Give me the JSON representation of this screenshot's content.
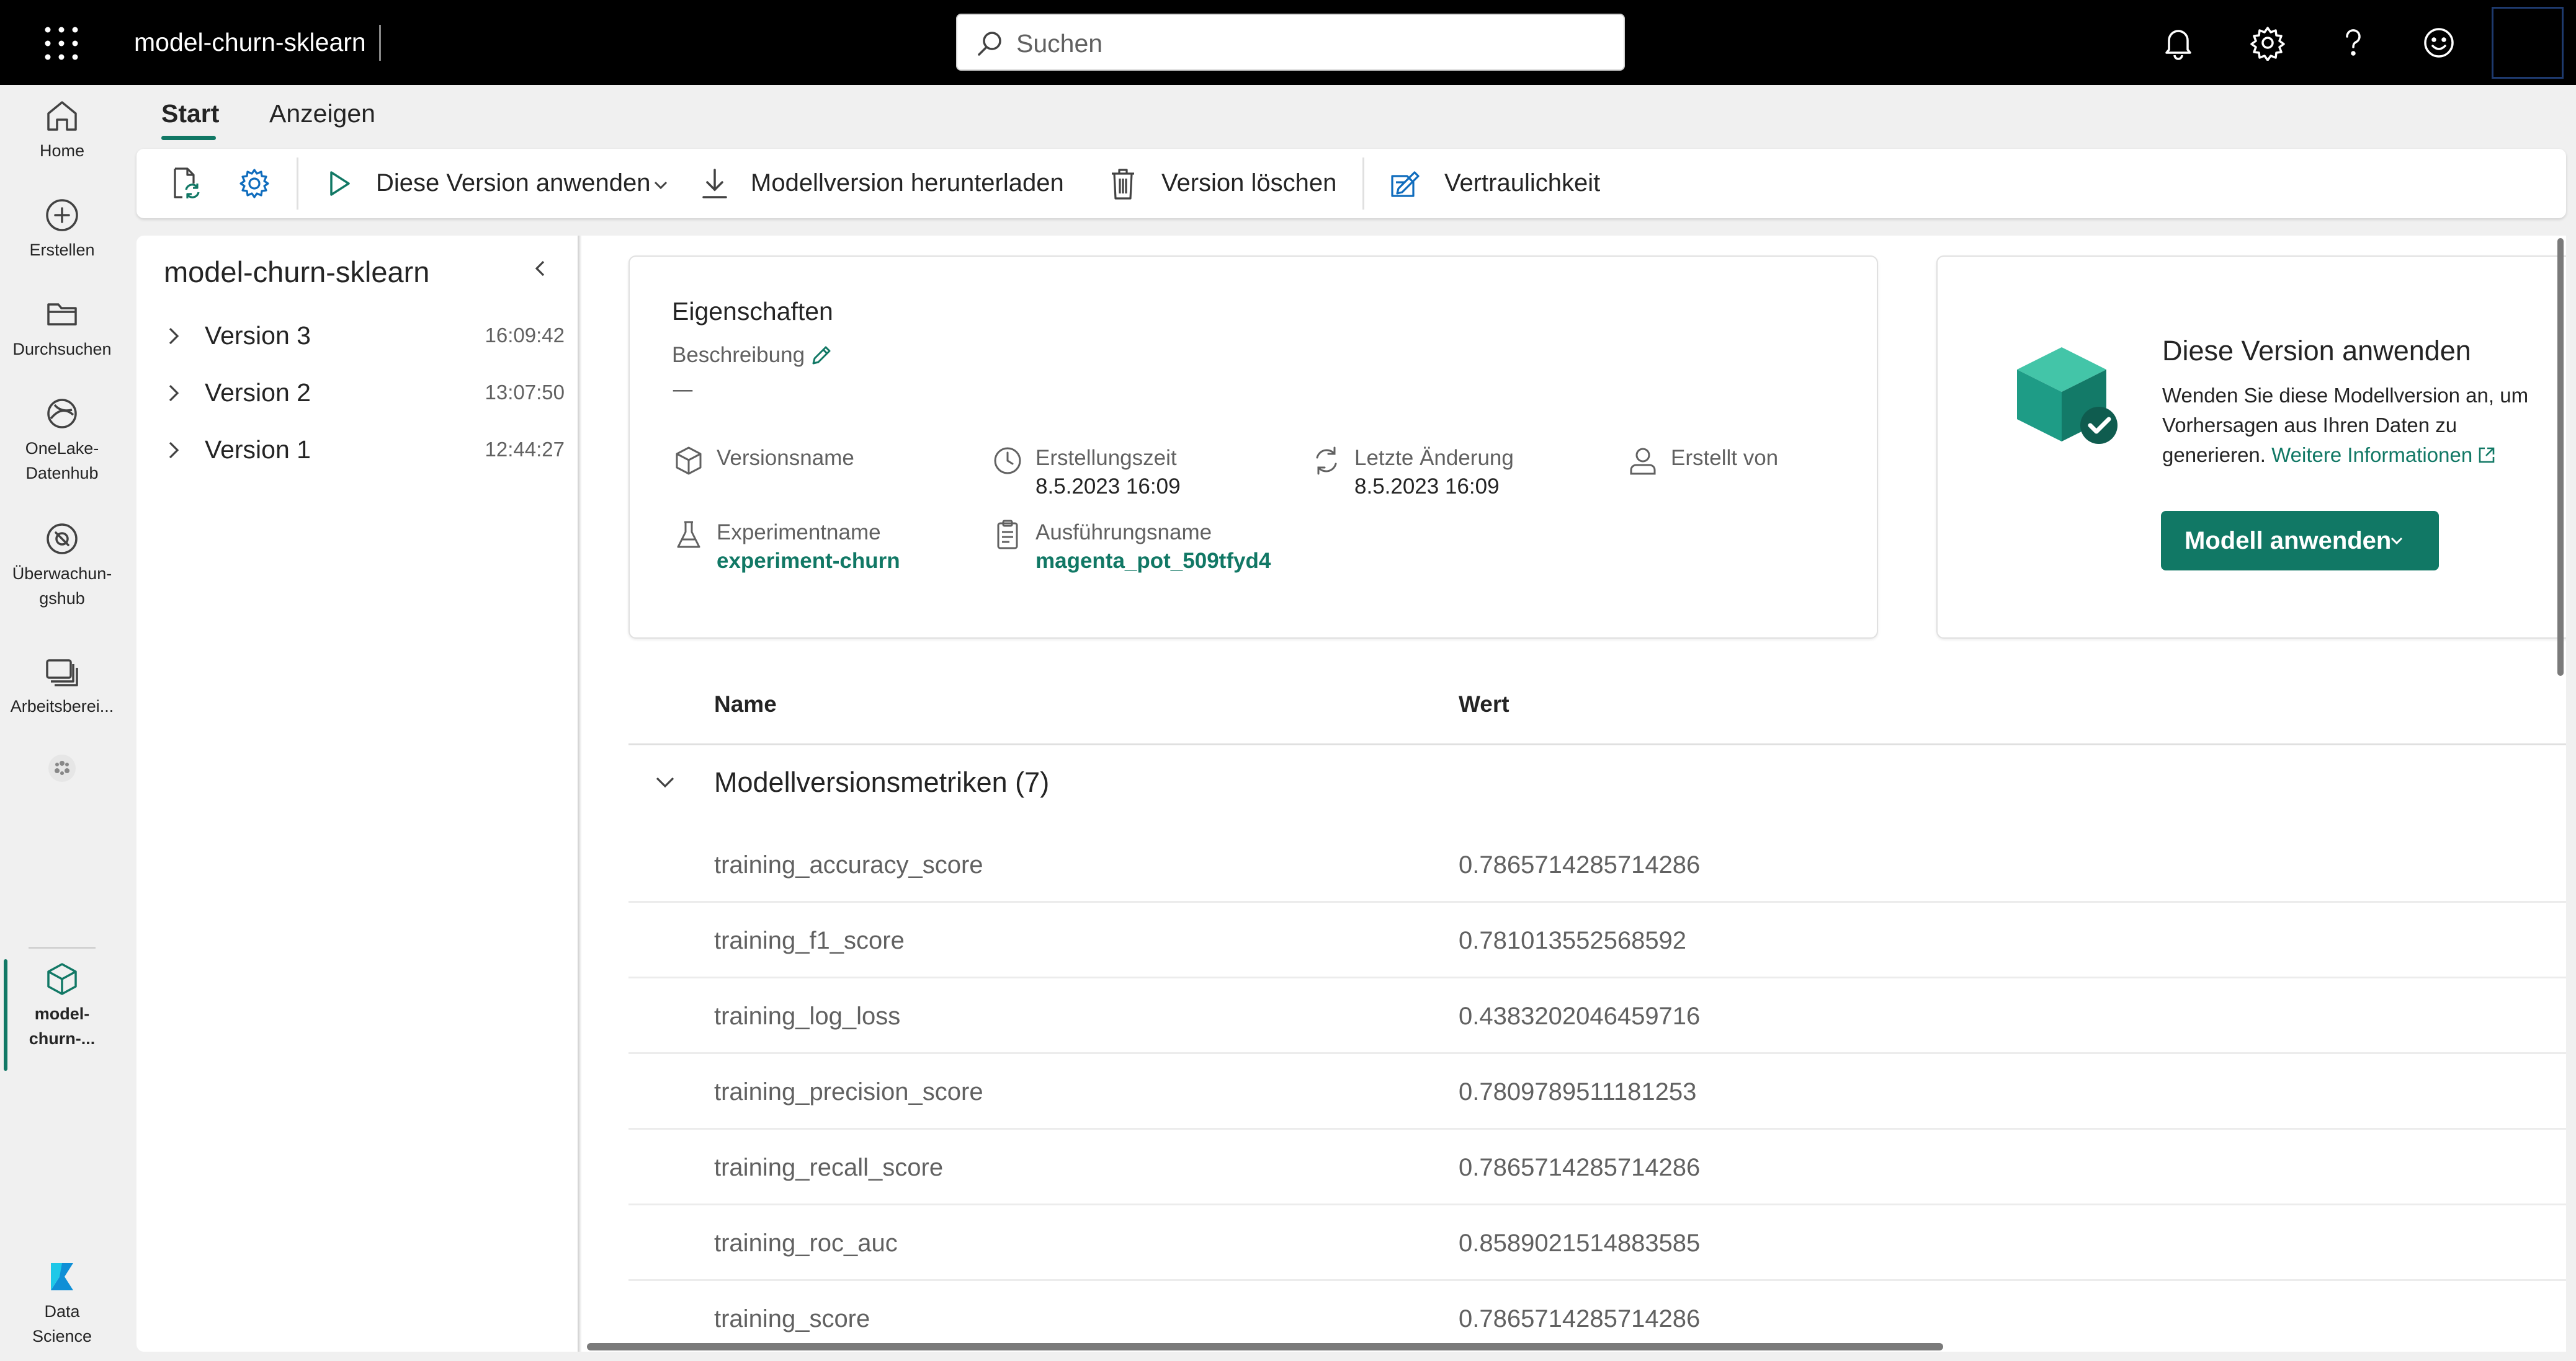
{
  "colors": {
    "accent": "#117865",
    "topbar": "#000000",
    "icon_gray": "#616161"
  },
  "header": {
    "app_title": "model-churn-sklearn",
    "search_placeholder": "Suchen"
  },
  "rail": {
    "items": [
      {
        "label": "Home",
        "icon": "home-icon"
      },
      {
        "label": "Erstellen",
        "icon": "plus-circle-icon"
      },
      {
        "label": "Durchsuchen",
        "icon": "folder-icon"
      },
      {
        "label": "OneLake-Datenhub",
        "icon": "onelake-icon"
      },
      {
        "label": "Überwachun-gshub",
        "icon": "monitor-icon"
      },
      {
        "label": "Arbeitsberei...",
        "icon": "workspaces-icon"
      },
      {
        "label": "",
        "icon": "workspace-avatar-icon"
      },
      {
        "label": "model-churn-...",
        "icon": "model-cube-icon"
      },
      {
        "label": "Data Science",
        "icon": "data-science-icon"
      }
    ]
  },
  "tabs": [
    {
      "label": "Start"
    },
    {
      "label": "Anzeigen"
    }
  ],
  "ribbon": {
    "apply_version": "Diese Version anwenden",
    "download": "Modellversion herunterladen",
    "delete": "Version löschen",
    "sensitivity": "Vertraulichkeit"
  },
  "versions_panel": {
    "title": "model-churn-sklearn",
    "items": [
      {
        "name": "Version 3",
        "time": "16:09:42"
      },
      {
        "name": "Version 2",
        "time": "13:07:50"
      },
      {
        "name": "Version 1",
        "time": "12:44:27"
      }
    ]
  },
  "properties": {
    "title": "Eigenschaften",
    "description_label": "Beschreibung",
    "description_value": "—",
    "version_name_label": "Versionsname",
    "version_name_value": "",
    "created_label": "Erstellungszeit",
    "created_value": "8.5.2023 16:09",
    "modified_label": "Letzte Änderung",
    "modified_value": "8.5.2023 16:09",
    "created_by_label": "Erstellt von",
    "created_by_value": "",
    "experiment_label": "Experimentname",
    "experiment_value": "experiment-churn",
    "run_label": "Ausführungsname",
    "run_value": "magenta_pot_509tfyd4"
  },
  "apply_card": {
    "title": "Diese Version anwenden",
    "description": "Wenden Sie diese Modellversion an, um Vorhersagen aus Ihren Daten zu generieren.",
    "link": "Weitere Informationen",
    "button": "Modell anwenden"
  },
  "metrics_table": {
    "col_name": "Name",
    "col_value": "Wert",
    "group_title": "Modellversionsmetriken (7)",
    "rows": [
      {
        "name": "training_accuracy_score",
        "value": "0.7865714285714286"
      },
      {
        "name": "training_f1_score",
        "value": "0.781013552568592"
      },
      {
        "name": "training_log_loss",
        "value": "0.4383202046459716"
      },
      {
        "name": "training_precision_score",
        "value": "0.7809789511181253"
      },
      {
        "name": "training_recall_score",
        "value": "0.7865714285714286"
      },
      {
        "name": "training_roc_auc",
        "value": "0.8589021514883585"
      },
      {
        "name": "training_score",
        "value": "0.7865714285714286"
      }
    ]
  }
}
